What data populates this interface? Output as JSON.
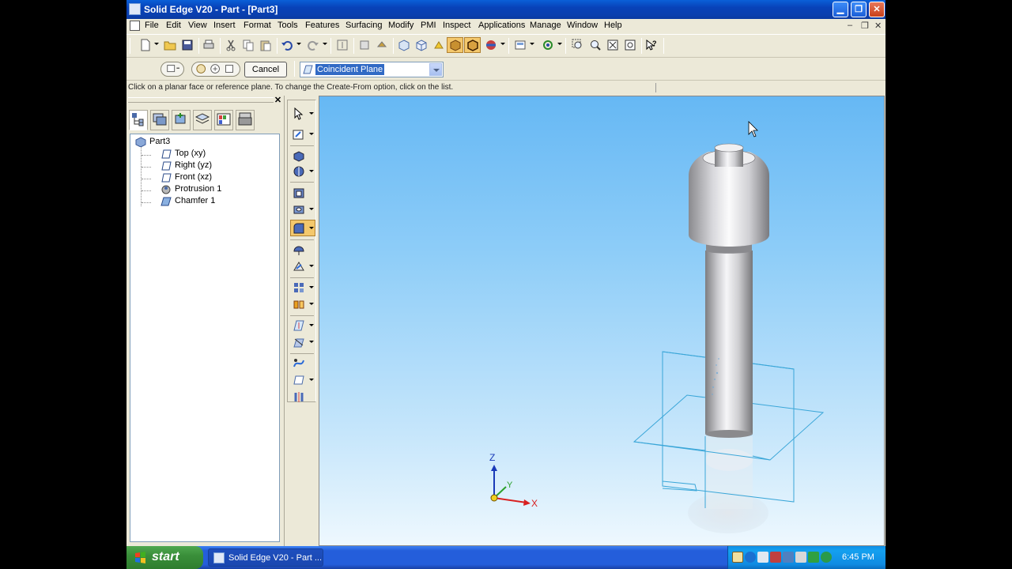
{
  "window": {
    "title": "Solid Edge V20 - Part - [Part3]",
    "min_symbol": "▁",
    "max_symbol": "❐",
    "close_symbol": "✕"
  },
  "menu": {
    "items": [
      "File",
      "Edit",
      "View",
      "Insert",
      "Format",
      "Tools",
      "Features",
      "Surfacing",
      "Modify",
      "PMI",
      "Inspect",
      "Applications",
      "Manage",
      "Window",
      "Help"
    ],
    "mdi_min": "–",
    "mdi_restore": "❐",
    "mdi_close": "✕"
  },
  "ribbon": {
    "cancel_label": "Cancel",
    "create_from_value": "Coincident Plane"
  },
  "prompt": {
    "text": "Click on a planar face or reference plane.  To change the Create-From option, click on the list."
  },
  "panel": {
    "close_symbol": "✕",
    "tabs": [
      "feature-pathfinder-icon",
      "layers-icon",
      "features-library-icon",
      "sensors-icon",
      "family-of-parts-icon",
      "feature-playback-icon"
    ]
  },
  "tree": {
    "root": "Part3",
    "items": [
      {
        "label": "Top (xy)",
        "icon": "reference-plane-icon"
      },
      {
        "label": "Right (yz)",
        "icon": "reference-plane-icon"
      },
      {
        "label": "Front (xz)",
        "icon": "reference-plane-icon"
      },
      {
        "label": "Protrusion 1",
        "icon": "protrusion-icon"
      },
      {
        "label": "Chamfer 1",
        "icon": "chamfer-icon"
      }
    ]
  },
  "viewport": {
    "axis_x": "X",
    "axis_y": "Y",
    "axis_z": "Z",
    "background_top": "#66b8f4",
    "background_bottom": "#eef8fe",
    "plane_color": "#3aa6d8"
  },
  "taskbar": {
    "start_label": "start",
    "task_label": "Solid Edge V20 - Part ...",
    "clock": "6:45 PM"
  }
}
